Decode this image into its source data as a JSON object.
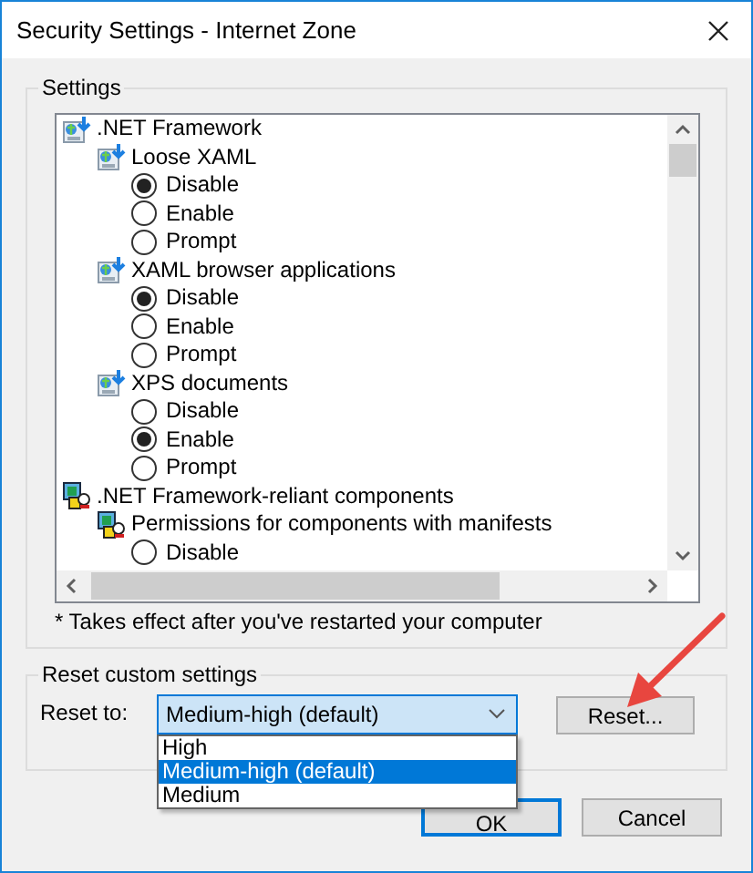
{
  "window": {
    "title": "Security Settings - Internet Zone"
  },
  "settings": {
    "label": "Settings",
    "items": [
      {
        "label": ".NET Framework",
        "kind": "net-group",
        "children": [
          {
            "label": "Loose XAML",
            "kind": "net-group",
            "children": [
              {
                "label": "Disable",
                "kind": "option",
                "selected": true
              },
              {
                "label": "Enable",
                "kind": "option",
                "selected": false
              },
              {
                "label": "Prompt",
                "kind": "option",
                "selected": false
              }
            ]
          },
          {
            "label": "XAML browser applications",
            "kind": "net-group",
            "children": [
              {
                "label": "Disable",
                "kind": "option",
                "selected": true
              },
              {
                "label": "Enable",
                "kind": "option",
                "selected": false
              },
              {
                "label": "Prompt",
                "kind": "option",
                "selected": false
              }
            ]
          },
          {
            "label": "XPS documents",
            "kind": "net-group",
            "children": [
              {
                "label": "Disable",
                "kind": "option",
                "selected": false
              },
              {
                "label": "Enable",
                "kind": "option",
                "selected": true
              },
              {
                "label": "Prompt",
                "kind": "option",
                "selected": false
              }
            ]
          }
        ]
      },
      {
        "label": ".NET Framework-reliant components",
        "kind": "component-group",
        "children": [
          {
            "label": "Permissions for components with manifests",
            "kind": "component-group",
            "children": [
              {
                "label": "Disable",
                "kind": "option",
                "selected": false
              }
            ]
          }
        ]
      }
    ],
    "note": "* Takes effect after you've restarted your computer"
  },
  "reset": {
    "label": "Reset custom settings",
    "field_label": "Reset to:",
    "select": {
      "value": "Medium-high (default)",
      "expanded": true,
      "options": [
        {
          "label": "High",
          "selected": false
        },
        {
          "label": "Medium-high (default)",
          "selected": true
        },
        {
          "label": "Medium",
          "selected": false
        }
      ]
    },
    "button": "Reset..."
  },
  "buttons": [
    "OK",
    "Cancel"
  ]
}
